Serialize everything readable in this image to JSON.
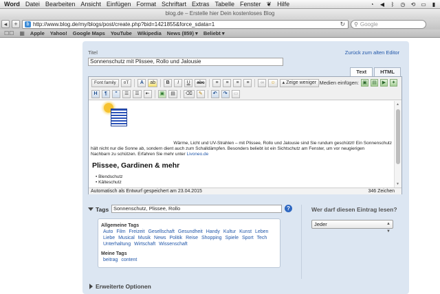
{
  "menubar": {
    "items": [
      "Word",
      "Datei",
      "Bearbeiten",
      "Ansicht",
      "Einfügen",
      "Format",
      "Schriftart",
      "Extras",
      "Tabelle",
      "Fenster",
      "Hilfe"
    ]
  },
  "window": {
    "title": "blog.de – Erstelle hier Dein kostenloses Blog"
  },
  "browser": {
    "url": "http://www.blog.de/my/blogs/post/create.php?bid=1421855&force_sdata=1",
    "search_placeholder": "Google",
    "bookmarks": [
      "Apple",
      "Yahoo!",
      "Google Maps",
      "YouTube",
      "Wikipedia",
      "News (859) ▾",
      "Beliebt ▾"
    ]
  },
  "form": {
    "title_label": "Titel",
    "back_link": "Zurück zum alten Editor",
    "title_value": "Sonnenschutz mit Plissee, Rollo und Jalousie",
    "tabs": [
      "Text",
      "HTML"
    ]
  },
  "editor": {
    "font_family": "Font family",
    "font_size": "¤T",
    "zeige_weniger": "Zeige weniger",
    "medien_label": "Medien einfügen:",
    "para_line1": "Wärme, Licht und UV-Strahlen – mit Plissee, Rollo und Jalousie sind Sie rundum geschützt! Ein Sonnenschutz",
    "para_line2": "hält nicht nur die Sonne ab, sondern dient auch zum Schalldämpfen. Besonders beliebt ist ein Sichtschutz am Fenster, um vor neugierigen",
    "para_line3_pre": "Nachbarn zu schützen. Erfahren Sie mehr unter",
    "para_link": "Livoneo.de",
    "heading": "Plissee, Gardinen & mehr",
    "bullets": [
      "Blendschutz",
      "Kälteschutz"
    ],
    "status_left": "Automatisch als Entwurf gespeichert am 23.04.2015",
    "status_right": "346 Zeichen"
  },
  "tags": {
    "label": "Tags",
    "value": "Sonnenschutz, Plissee, Rollo",
    "help": "?",
    "general_heading": "Allgemeine Tags",
    "general": [
      "Auto",
      "Film",
      "Freizeit",
      "Gesellschaft",
      "Gesundheit",
      "Handy",
      "Kultur",
      "Kunst",
      "Leben",
      "Liebe",
      "Musical",
      "Musik",
      "News",
      "Politik",
      "Reise",
      "Shopping",
      "Spiele",
      "Sport",
      "Tech",
      "Unterhaltung",
      "Wirtschaft",
      "Wissenschaft"
    ],
    "mine_heading": "Meine Tags",
    "mine": [
      "beitrag",
      "content"
    ]
  },
  "visibility": {
    "label": "Wer darf diesen Eintrag lesen?",
    "selected": "Jeder"
  },
  "advanced": {
    "label": "Erweiterte Optionen"
  }
}
